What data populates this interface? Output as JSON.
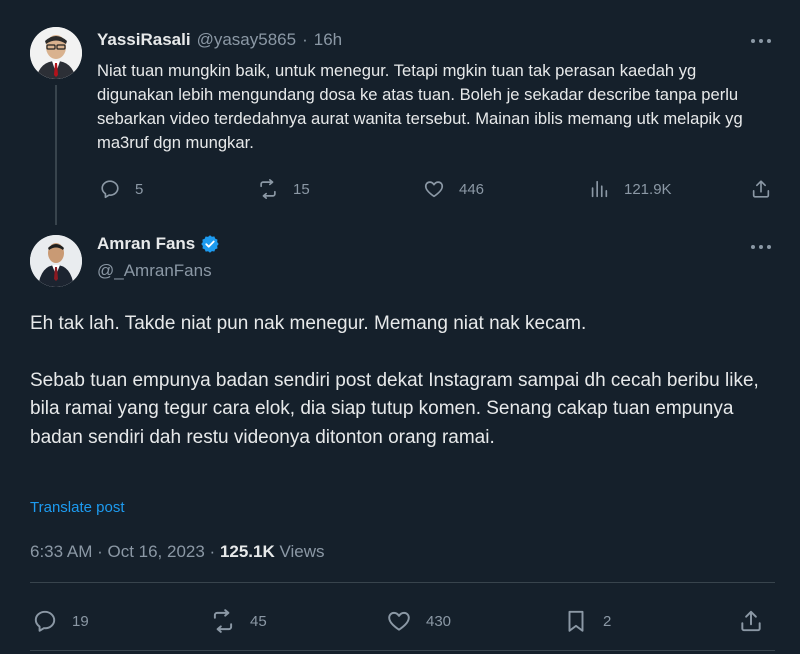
{
  "reply": {
    "author_name": "YassiRasali",
    "handle": "@yasay5865",
    "separator": "·",
    "time": "16h",
    "text": "Niat tuan mungkin baik, untuk menegur. Tetapi mgkin tuan tak perasan kaedah yg digunakan lebih mengundang dosa ke atas tuan. Boleh je sekadar describe tanpa perlu sebarkan video terdedahnya aurat wanita tersebut. Mainan iblis memang utk melapik yg ma3ruf dgn mungkar.",
    "stats": {
      "replies": "5",
      "reposts": "15",
      "likes": "446",
      "views": "121.9K"
    }
  },
  "main": {
    "author_name": "Amran Fans",
    "handle": "@_AmranFans",
    "verified_color": "#1d9bf0",
    "paragraph1": "Eh tak lah. Takde niat pun nak menegur. Memang niat nak kecam.",
    "paragraph2": "Sebab tuan empunya badan sendiri post dekat Instagram sampai dh cecah beribu like, bila ramai yang tegur cara elok, dia siap tutup komen. Senang cakap tuan empunya badan sendiri dah restu videonya ditonton orang ramai.",
    "translate_label": "Translate post",
    "timestamp": "6:33 AM · Oct 16, 2023",
    "meta_sep": " · ",
    "views_count": "125.1K",
    "views_label": " Views",
    "stats": {
      "replies": "19",
      "reposts": "45",
      "likes": "430",
      "bookmarks": "2"
    }
  },
  "icons": {
    "reply": "reply-icon",
    "repost": "repost-icon",
    "like": "heart-icon",
    "views": "views-icon",
    "share": "share-icon",
    "bookmark": "bookmark-icon",
    "more": "more-icon",
    "verified": "verified-badge-icon"
  }
}
